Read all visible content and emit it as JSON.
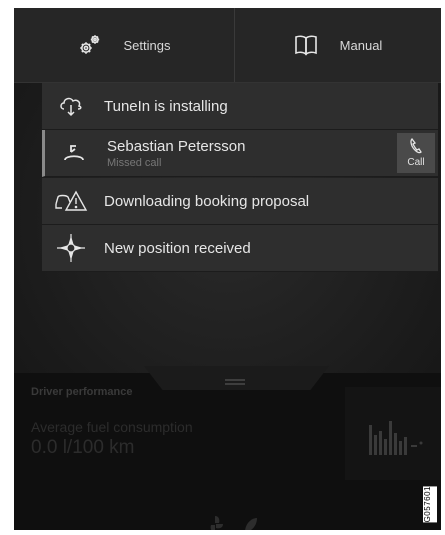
{
  "topbar": {
    "settings_label": "Settings",
    "manual_label": "Manual",
    "settings_icon": "gears-icon",
    "manual_icon": "book-icon"
  },
  "notifications": [
    {
      "title": "TuneIn is installing",
      "icon": "cloud-download-icon"
    },
    {
      "title": "Sebastian Petersson",
      "subtitle": "Missed call",
      "icon": "missed-call-icon",
      "action_label": "Call"
    },
    {
      "title": "Downloading booking proposal",
      "icon": "car-warning-icon"
    },
    {
      "title": "New position received",
      "icon": "compass-icon"
    }
  ],
  "driver_panel": {
    "title": "Driver performance",
    "metric_label": "Average fuel consumption",
    "metric_value": "0.0 l/100 km"
  },
  "figure_id": "G057601"
}
